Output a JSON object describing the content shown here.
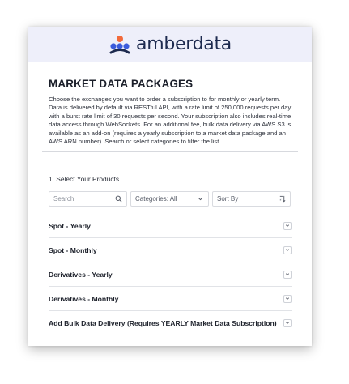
{
  "brand": {
    "name": "amberdata"
  },
  "page": {
    "title": "MARKET DATA PACKAGES",
    "description": "Choose the exchanges you want to order a subscription to for monthly or yearly term. Data is delivered by default via RESTful API, with a rate limit of 250,000 requests per day with a burst rate limit of 30 requests per second. Your subscription also includes real-time data access through WebSockets. For an additional fee, bulk data delivery via AWS S3 is available as an add-on (requires a yearly subscription to a market data package and an AWS ARN number). Search or select categories to filter the list."
  },
  "step": {
    "label": "1. Select Your Products"
  },
  "filters": {
    "search_placeholder": "Search",
    "category_value": "Categories: All",
    "sort_value": "Sort By"
  },
  "products": [
    {
      "label": "Spot - Yearly"
    },
    {
      "label": "Spot - Monthly"
    },
    {
      "label": "Derivatives - Yearly"
    },
    {
      "label": "Derivatives - Monthly"
    },
    {
      "label": "Add Bulk Data Delivery (Requires YEARLY Market Data Subscription)"
    }
  ],
  "colors": {
    "header_bg": "#eeeffa",
    "brand_text": "#1d2a4f",
    "logo_orange": "#f26a3b",
    "logo_blue": "#3b5bdb",
    "logo_navy": "#1d2a4f"
  },
  "icons": {
    "search": "search-icon",
    "dropdown": "chevron-down-icon",
    "sort": "sort-icon",
    "row_toggle": "chevron-down-icon"
  }
}
